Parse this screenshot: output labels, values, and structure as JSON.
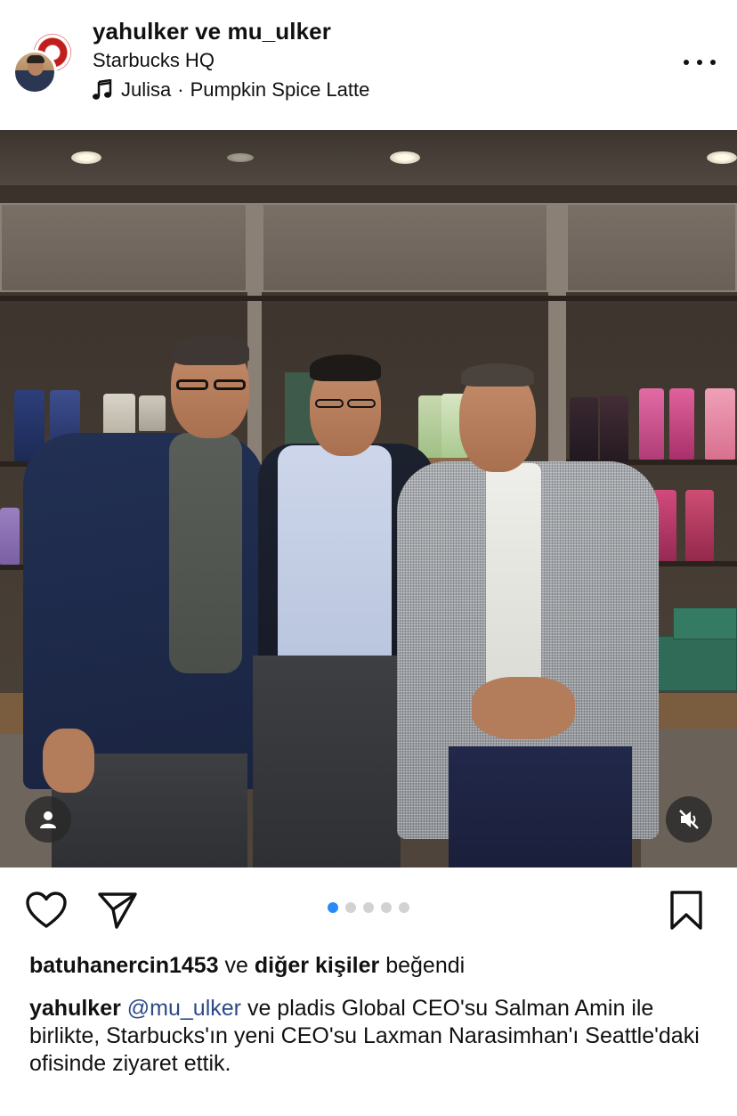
{
  "header": {
    "username_primary": "yahulker",
    "username_connector": "ve",
    "username_secondary": "mu_ulker",
    "location": "Starbucks HQ",
    "music": {
      "artist": "Julisa",
      "separator": "·",
      "track": "Pumpkin Spice Latte",
      "icon": "music-note-icon"
    },
    "more_icon": "more-horizontal-icon"
  },
  "photo": {
    "tag_icon": "person-tag-icon",
    "mute_icon": "muted-speaker-icon"
  },
  "actions": {
    "like_icon": "heart-icon",
    "share_icon": "send-icon",
    "save_icon": "bookmark-icon",
    "carousel": {
      "total": 5,
      "active_index": 0,
      "active_color": "#2a8af5",
      "inactive_color": "#d2d2d2"
    }
  },
  "likes": {
    "user": "batuhanercin1453",
    "connector": "ve",
    "others": "diğer kişiler",
    "suffix": "beğendi"
  },
  "caption": {
    "author": "yahulker",
    "mention": "@mu_ulker",
    "text": "ve pladis Global CEO'su Salman Amin ile birlikte, Starbucks'ın yeni CEO'su Laxman Narasimhan'ı Seattle'daki ofisinde ziyaret ettik."
  },
  "colors": {
    "mention": "#2c4a8a",
    "text": "#111111",
    "background": "#ffffff"
  }
}
